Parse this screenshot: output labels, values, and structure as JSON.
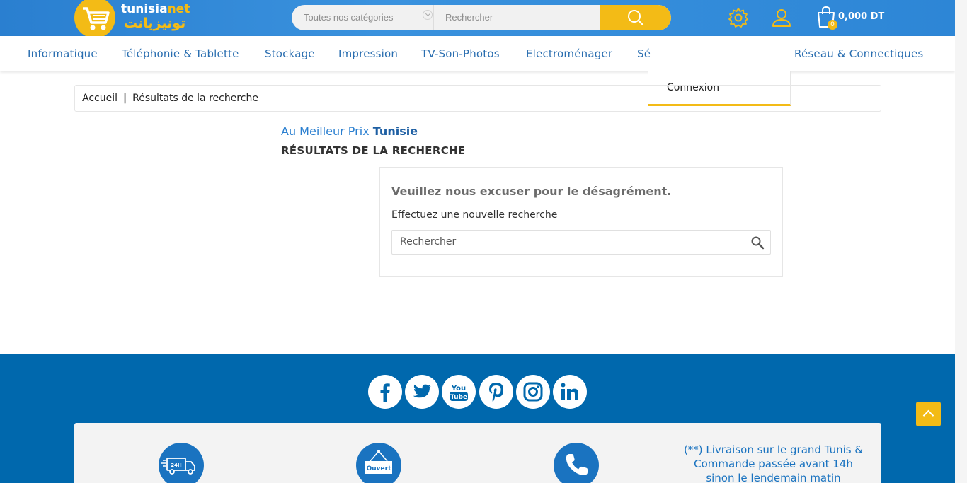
{
  "header": {
    "logo_latin": "tunisia",
    "logo_latin_accent": "net",
    "logo_arabic": "تونيزيانت",
    "category_select": "Toutes nos catégories",
    "search_placeholder": "Rechercher",
    "cart_count": "0",
    "cart_total": "0,000 DT"
  },
  "nav": {
    "items": [
      "Informatique",
      "Téléphonie & Tablette",
      "Stockage",
      "Impression",
      "TV-Son-Photos",
      "Electroménager",
      "Sé",
      "Réseau & Connectiques"
    ],
    "dropdown": {
      "login": "Connexion"
    }
  },
  "breadcrumb": {
    "home": "Accueil",
    "separator": "|",
    "current": "Résultats de la recherche"
  },
  "main": {
    "subtitle_prefix": "Au Meilleur Prix",
    "subtitle_strong": "Tunisie",
    "title": "RÉSULTATS DE LA RECHERCHE",
    "no_result_title": "Veuillez nous excuser pour le désagrément.",
    "no_result_sub": "Effectuez une nouvelle recherche",
    "search_placeholder": "Rechercher"
  },
  "footer": {
    "social": [
      "facebook-icon",
      "twitter-icon",
      "youtube-icon",
      "pinterest-icon",
      "instagram-icon",
      "linkedin-icon"
    ],
    "feature_delivery_badge": "24H",
    "feature_open_sign": "Ouvert",
    "note": "(**) Livraison sur le grand Tunis & Commande passée avant 14h sinon le lendemain matin"
  },
  "colors": {
    "primary": "#2a7fd0",
    "accent": "#f3bb16",
    "footer": "#0068ad",
    "nav_text": "#2a6eb0"
  }
}
